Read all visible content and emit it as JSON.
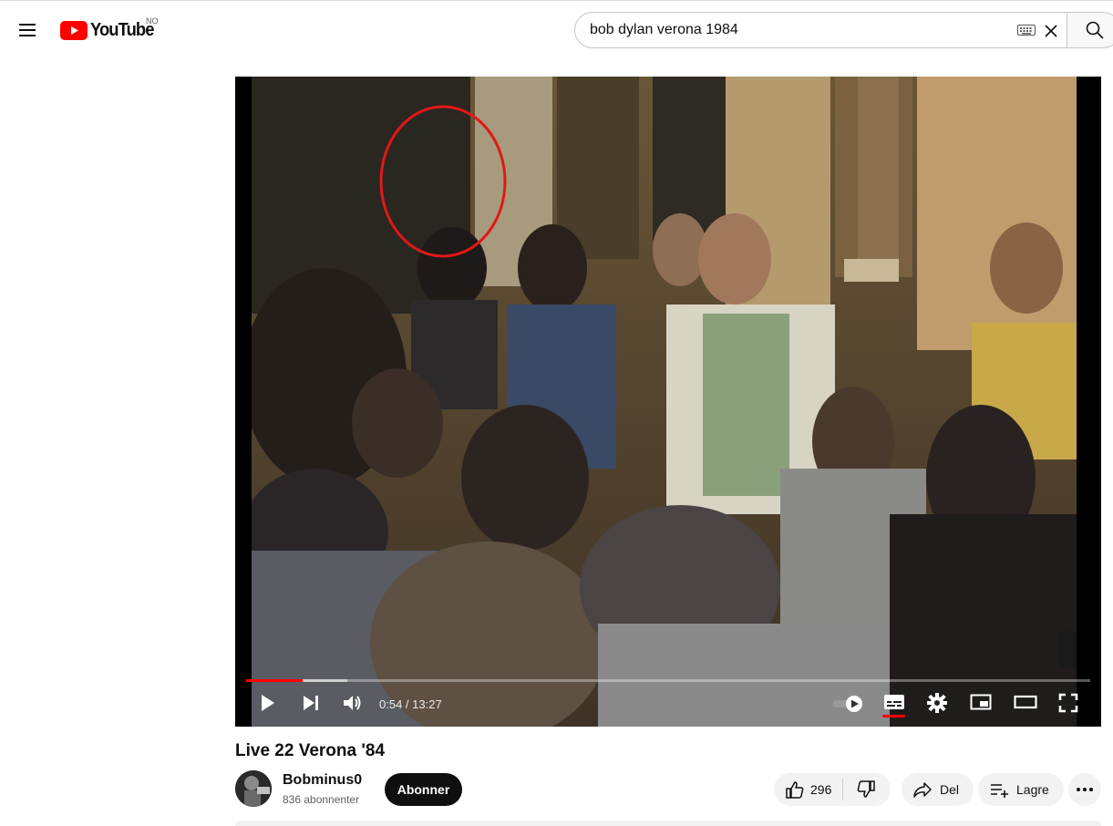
{
  "header": {
    "logo_text": "YouTube",
    "country_code": "NO",
    "search_query": "bob dylan verona 1984",
    "brand_color": "#ff0000"
  },
  "player": {
    "current_time": "0:54",
    "duration": "13:27",
    "time_display": "0:54 / 13:27",
    "played_fraction": 0.067,
    "buffered_fraction": 0.12,
    "progress_color": "#ff0000",
    "controls": [
      "play-icon",
      "next-icon",
      "volume-icon",
      "autoplay-toggle-icon",
      "subtitles-icon",
      "settings-icon",
      "miniplayer-icon",
      "theater-mode-icon",
      "fullscreen-icon"
    ]
  },
  "video": {
    "title": "Live 22 Verona '84"
  },
  "channel": {
    "name": "Bobminus0",
    "subscribers": "836 abonnenter",
    "subscribe_label": "Abonner"
  },
  "actions": {
    "like_count": "296",
    "share_label": "Del",
    "save_label": "Lagre"
  }
}
